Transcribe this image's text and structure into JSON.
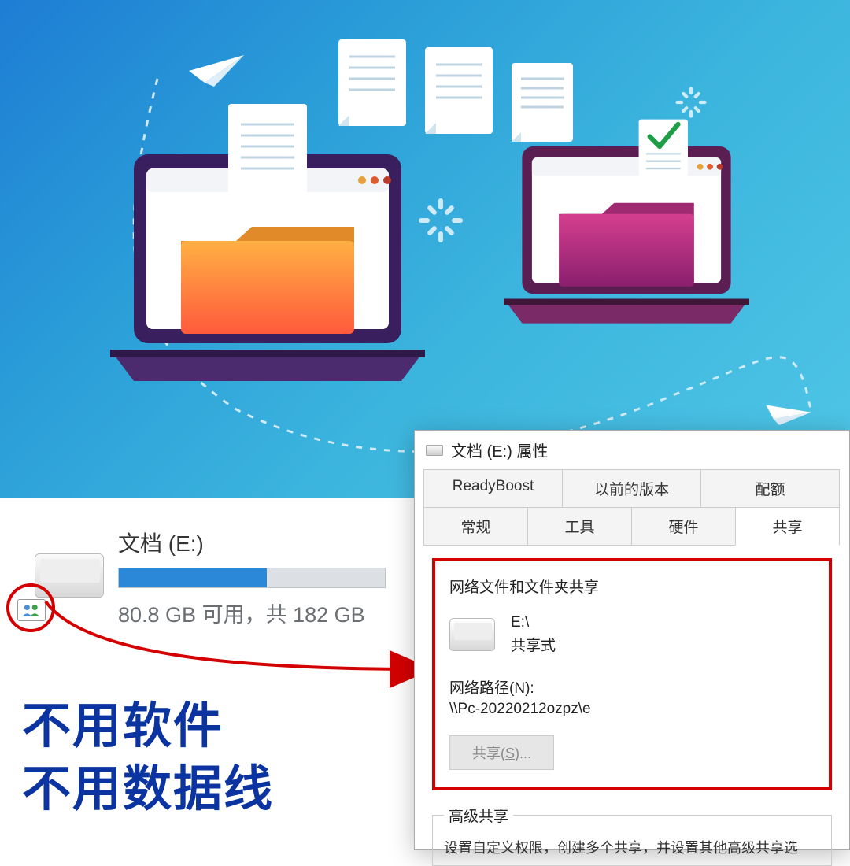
{
  "explorer": {
    "drive_label": "文档 (E:)",
    "storage_text": "80.8 GB 可用，共 182 GB",
    "usage_fill_percent": 55.6
  },
  "captions": {
    "line1": "不用软件",
    "line2": "不用数据线"
  },
  "dialog": {
    "title": "文档 (E:) 属性",
    "tabs_top": [
      "ReadyBoost",
      "以前的版本",
      "配额"
    ],
    "tabs_bottom": [
      "常规",
      "工具",
      "硬件",
      "共享"
    ],
    "active_tab": "共享",
    "share_section_title": "网络文件和文件夹共享",
    "share_drive_path": "E:\\",
    "share_state": "共享式",
    "net_path_label_pre": "网络路径(",
    "net_path_label_key": "N",
    "net_path_label_post": "):",
    "net_path_value": "\\\\Pc-20220212ozpz\\e",
    "share_button_pre": "共享(",
    "share_button_key": "S",
    "share_button_post": ")...",
    "adv_title": "高级共享",
    "adv_text": "设置自定义权限，创建多个共享，并设置其他高级共享选"
  }
}
